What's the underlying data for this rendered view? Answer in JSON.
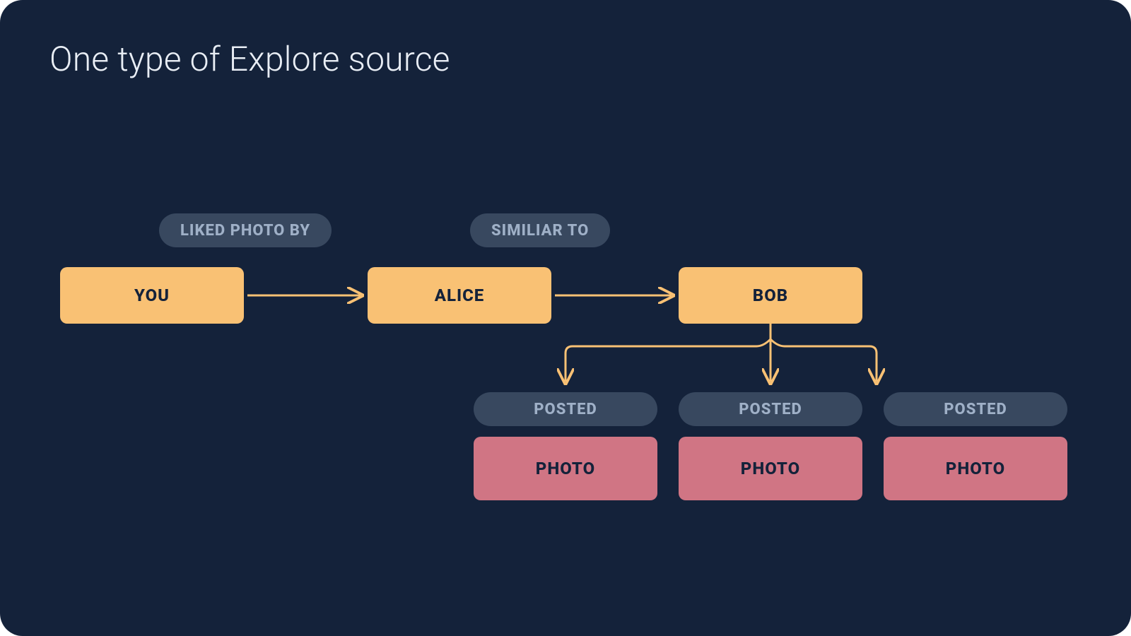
{
  "title": "One type of Explore source",
  "chain": {
    "you": "YOU",
    "alice": "ALICE",
    "bob": "BOB",
    "edge1": "LIKED PHOTO BY",
    "edge2": "SIMILIAR TO"
  },
  "posts": [
    {
      "label": "POSTED",
      "content": "PHOTO"
    },
    {
      "label": "POSTED",
      "content": "PHOTO"
    },
    {
      "label": "POSTED",
      "content": "PHOTO"
    }
  ],
  "colors": {
    "background": "#14223a",
    "node": "#f9c174",
    "pill": "#38485f",
    "pillText": "#9fb0c7",
    "photo": "#d07584",
    "arrow": "#f9c174"
  }
}
